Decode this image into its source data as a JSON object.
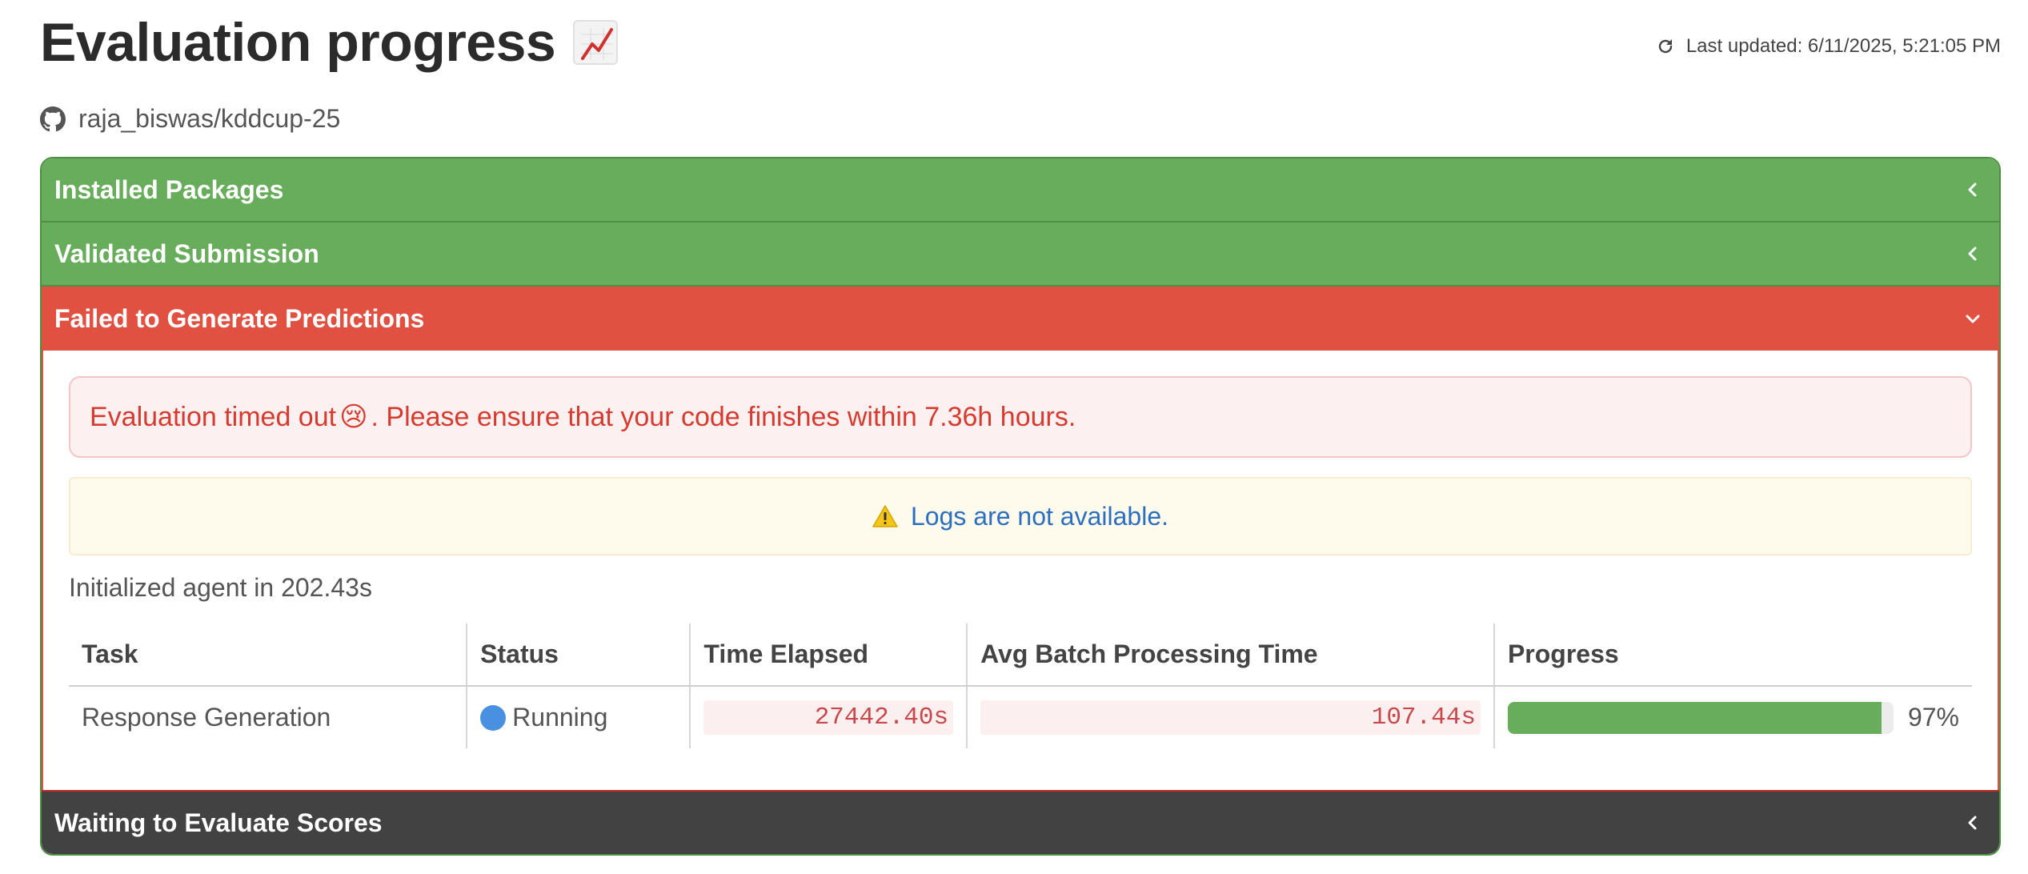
{
  "page": {
    "title": "Evaluation progress",
    "title_emoji": "chart-increasing-icon",
    "last_updated": "Last updated: 6/11/2025, 5:21:05 PM",
    "repo": "raja_biswas/kddcup-25"
  },
  "colors": {
    "success": "#67ad5b",
    "failure": "#e15141",
    "pending": "#424242",
    "error_text": "#d63b2f",
    "link": "#2c6fbf",
    "running": "#4a90e2"
  },
  "stages": [
    {
      "label": "Installed Packages",
      "state": "success",
      "expanded": false
    },
    {
      "label": "Validated Submission",
      "state": "success",
      "expanded": false
    },
    {
      "label": "Failed to Generate Predictions",
      "state": "failure",
      "expanded": true
    },
    {
      "label": "Waiting to Evaluate Scores",
      "state": "pending",
      "expanded": false
    }
  ],
  "failure_panel": {
    "error_before": "Evaluation timed out ",
    "error_emoji": "😢",
    "error_after": ". Please ensure that your code finishes within 7.36h hours.",
    "logs_warning": "Logs are not available.",
    "init_text": "Initialized agent in 202.43s",
    "table": {
      "headers": [
        "Task",
        "Status",
        "Time Elapsed",
        "Avg Batch Processing Time",
        "Progress"
      ],
      "rows": [
        {
          "task": "Response Generation",
          "status": "Running",
          "time_elapsed": "27442.40s",
          "avg_batch": "107.44s",
          "progress_value": 0.97,
          "progress_label": "97%"
        }
      ]
    }
  }
}
